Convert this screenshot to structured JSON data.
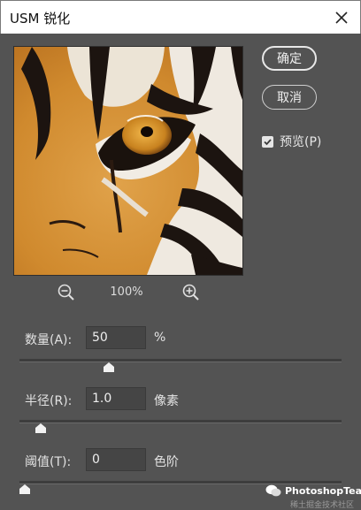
{
  "window": {
    "title": "USM 锐化",
    "close_icon": "close-icon"
  },
  "buttons": {
    "ok": "确定",
    "cancel": "取消"
  },
  "preview_toggle": {
    "label": "预览(P)",
    "checked": true
  },
  "zoom": {
    "level": "100%",
    "zoom_out_icon": "zoom-out-icon",
    "zoom_in_icon": "zoom-in-icon"
  },
  "params": {
    "amount": {
      "label": "数量(A):",
      "value": "50",
      "unit": "%",
      "slider_fraction": 0.27
    },
    "radius": {
      "label": "半径(R):",
      "value": "1.0",
      "unit": "像素",
      "slider_fraction": 0.05
    },
    "threshold": {
      "label": "阈值(T):",
      "value": "0",
      "unit": "色阶",
      "slider_fraction": 0.0
    }
  },
  "watermark": {
    "text": "PhotoshopTea",
    "subtext": "稀土掘金技术社区"
  },
  "colors": {
    "dialog_bg": "#535353",
    "titlebar_bg": "#ffffff",
    "accent": "#e6e6e6"
  }
}
